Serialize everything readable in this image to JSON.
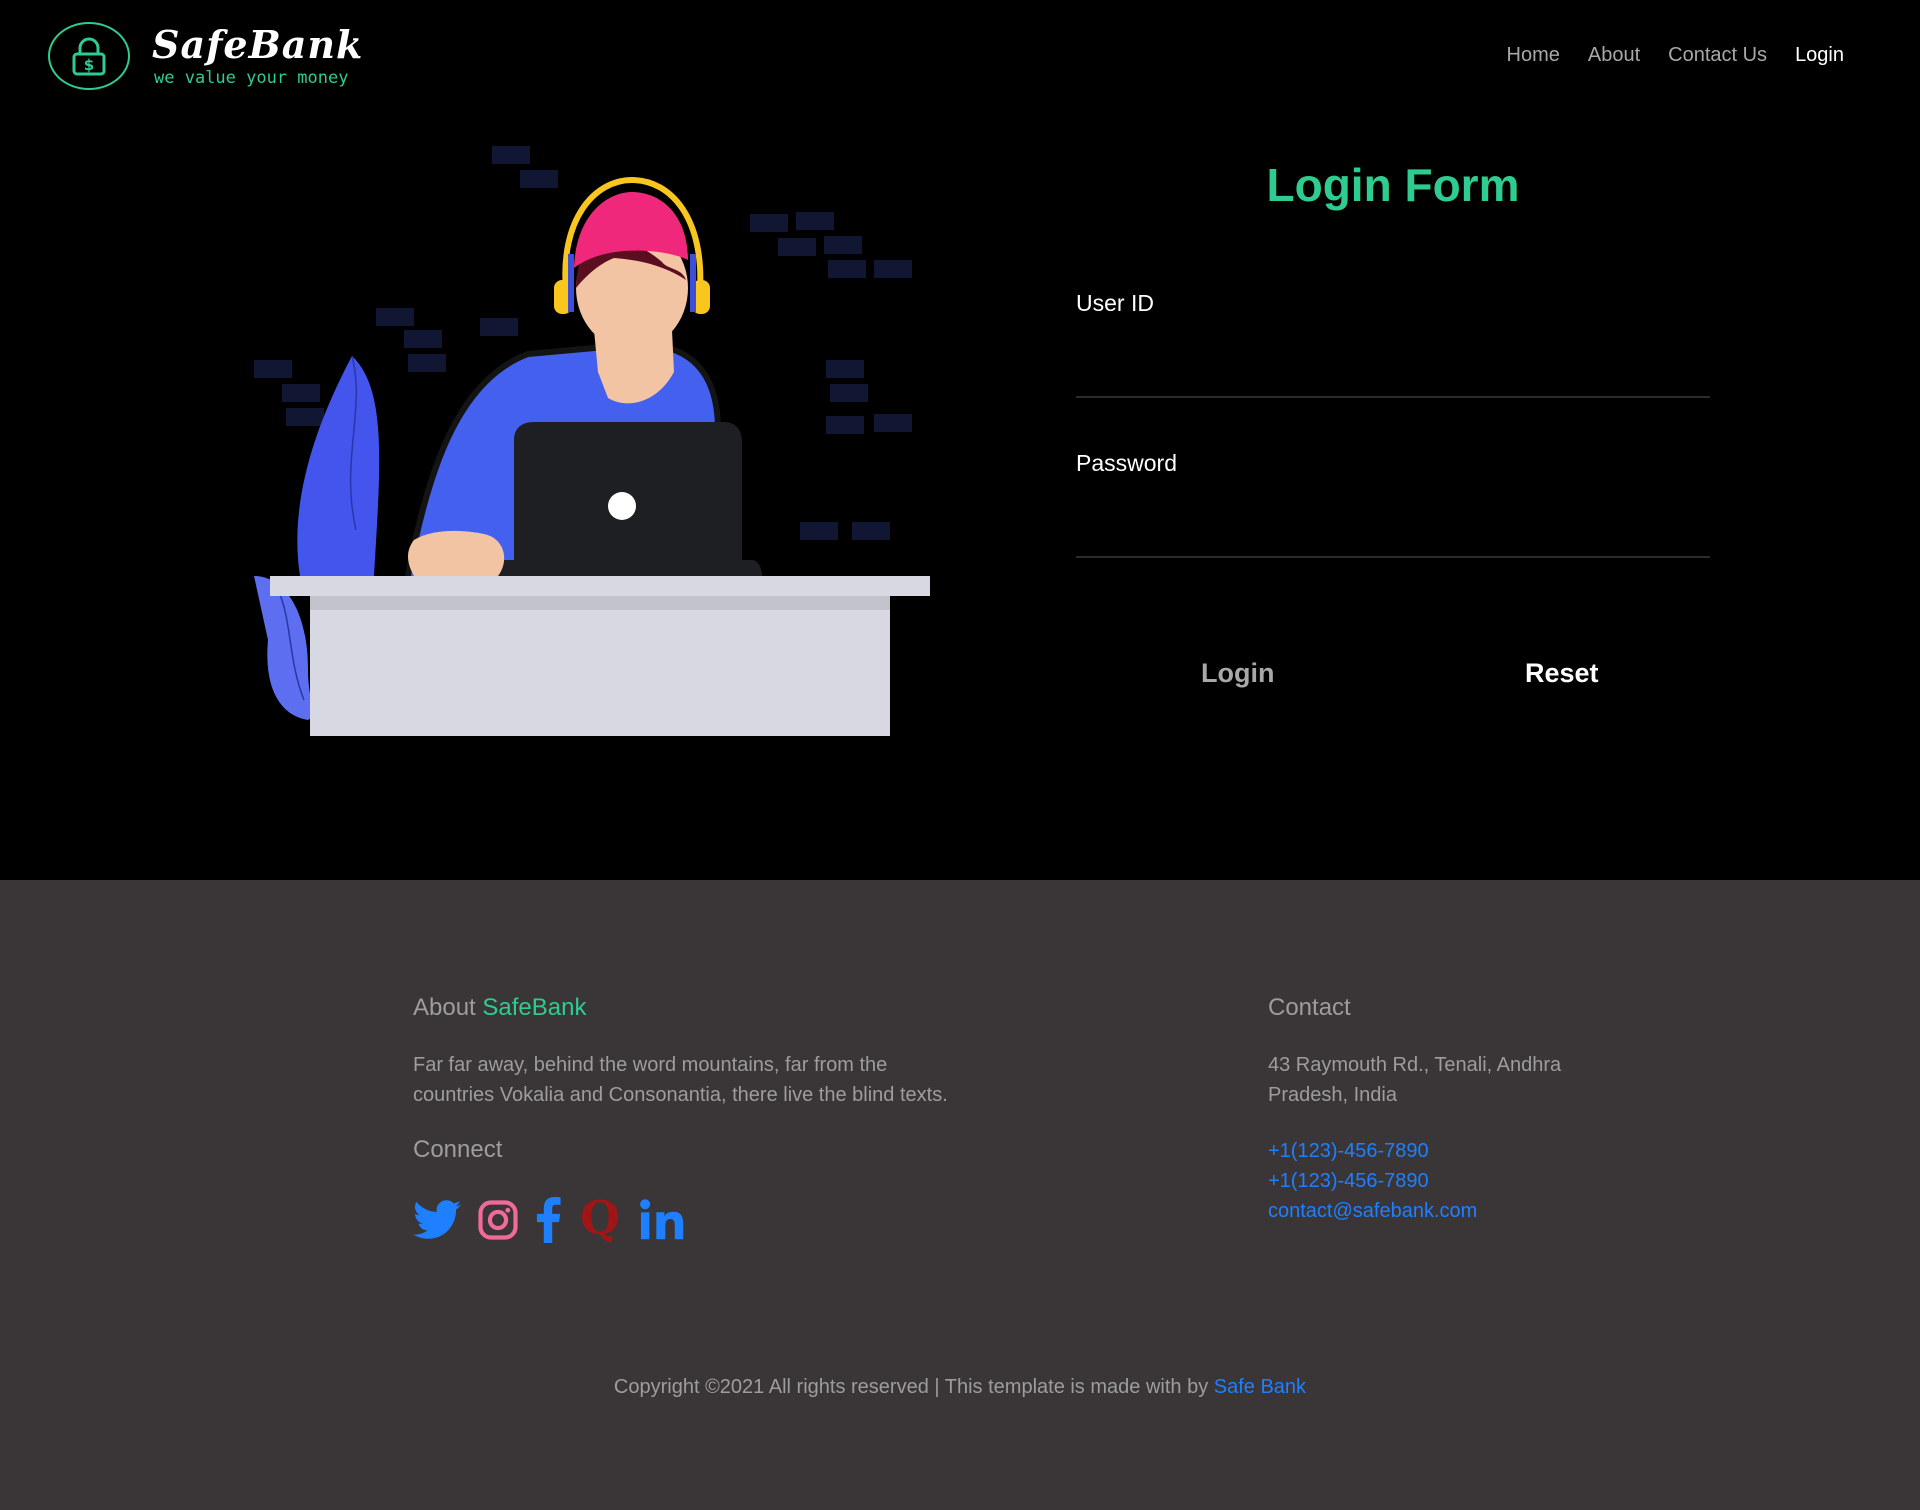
{
  "header": {
    "brand_name": "SafeBank",
    "brand_tagline": "we value your money",
    "nav": [
      "Home",
      "About",
      "Contact Us",
      "Login"
    ]
  },
  "form": {
    "title": "Login Form",
    "user_label": "User ID",
    "user_value": "",
    "password_label": "Password",
    "password_value": "",
    "login_button": "Login",
    "reset_button": "Reset"
  },
  "footer": {
    "about_prefix": "About",
    "about_brand": "SafeBank",
    "about_text": "Far far away, behind the word mountains, far from the countries Vokalia and Consonantia, there live the blind texts.",
    "connect_heading": "Connect",
    "social_icons": [
      "twitter-icon",
      "instagram-icon",
      "facebook-icon",
      "quora-icon",
      "linkedin-icon"
    ],
    "contact_heading": "Contact",
    "address": "43 Raymouth Rd., Tenali, Andhra Pradesh, India",
    "phone1": "+1(123)-456-7890",
    "phone2": "+1(123)-456-7890",
    "email": "contact@safebank.com",
    "copyright_text": "Copyright ©2021 All rights reserved | This template is made with by",
    "copyright_link": "Safe Bank"
  },
  "colors": {
    "accent_green": "#2ecc8f",
    "link_blue": "#1f80ff",
    "footer_bg": "#3a3536",
    "page_bg": "#000000"
  }
}
